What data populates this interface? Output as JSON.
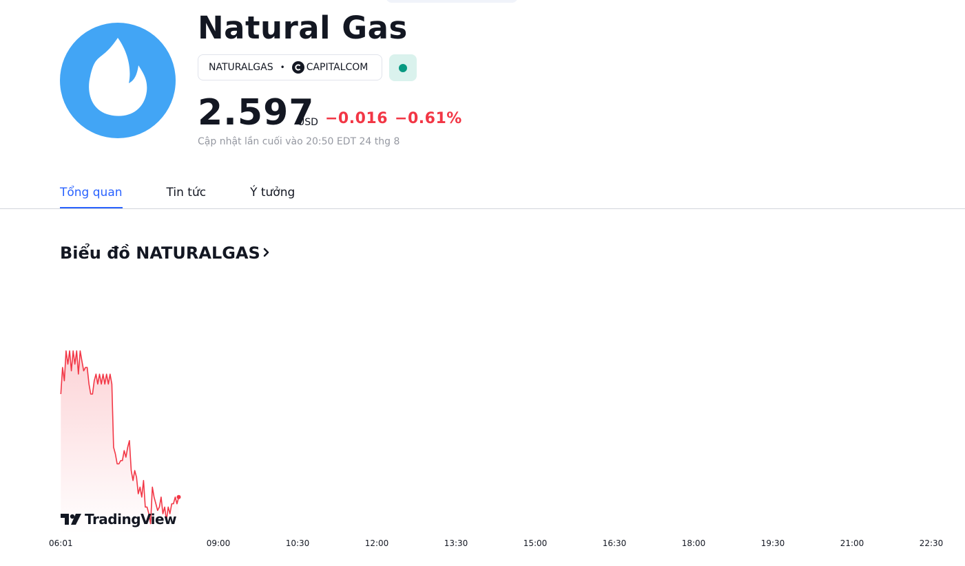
{
  "instrument": {
    "name": "Natural Gas",
    "symbol": "NATURALGAS",
    "separator": "•",
    "exchange": "CAPITALCOM",
    "logo_icon": "flame-icon",
    "logo_color": "#42a5f5",
    "market_status_color": "#089981"
  },
  "quote": {
    "price": "2.597",
    "currency": "USD",
    "change": "−0.016",
    "change_percent": "−0.61%",
    "change_color": "#f23645",
    "last_updated": "Cập nhật lần cuối vào 20:50 EDT 24 thg 8"
  },
  "tabs": [
    {
      "label": "Tổng quan",
      "active": true
    },
    {
      "label": "Tin tức",
      "active": false
    },
    {
      "label": "Ý tưởng",
      "active": false
    }
  ],
  "chart_section": {
    "title": "Biểu đồ NATURALGAS",
    "chevron_icon": "chevron-right-icon",
    "watermark": "TradingView"
  },
  "chart_data": {
    "type": "area",
    "line_color": "#f23645",
    "x_tick_labels": [
      "06:01",
      "09:00",
      "10:30",
      "12:00",
      "13:30",
      "15:00",
      "16:30",
      "18:00",
      "19:30",
      "21:00",
      "22:30"
    ],
    "x": [
      "06:01",
      "06:03",
      "06:05",
      "06:07",
      "06:09",
      "06:11",
      "06:13",
      "06:15",
      "06:17",
      "06:19",
      "06:21",
      "06:23",
      "06:25",
      "06:27",
      "06:29",
      "06:31",
      "06:33",
      "06:35",
      "06:37",
      "06:39",
      "06:41",
      "06:43",
      "06:45",
      "06:47",
      "06:49",
      "06:51",
      "06:53",
      "06:55",
      "06:57",
      "06:59",
      "07:01",
      "07:03",
      "07:05",
      "07:07",
      "07:09",
      "07:11",
      "07:13",
      "07:15",
      "07:17",
      "07:19",
      "07:21",
      "07:23",
      "07:25",
      "07:27",
      "07:29",
      "07:31",
      "07:33",
      "07:35",
      "07:37",
      "07:39",
      "07:41",
      "07:43",
      "07:45",
      "07:47",
      "07:49",
      "07:51",
      "07:53",
      "07:55",
      "07:57",
      "07:59",
      "08:01",
      "08:03",
      "08:05",
      "08:07",
      "08:09",
      "08:11",
      "08:13",
      "08:15"
    ],
    "y": [
      2.628,
      2.636,
      2.632,
      2.641,
      2.637,
      2.641,
      2.635,
      2.641,
      2.637,
      2.641,
      2.634,
      2.641,
      2.638,
      2.635,
      2.636,
      2.636,
      2.631,
      2.628,
      2.628,
      2.632,
      2.634,
      2.631,
      2.634,
      2.631,
      2.634,
      2.631,
      2.634,
      2.631,
      2.634,
      2.631,
      2.612,
      2.61,
      2.607,
      2.607,
      2.608,
      2.608,
      2.611,
      2.609,
      2.612,
      2.614,
      2.605,
      2.602,
      2.605,
      2.603,
      2.598,
      2.6,
      2.597,
      2.602,
      2.594,
      2.594,
      2.592,
      2.589,
      2.6,
      2.597,
      2.595,
      2.593,
      2.594,
      2.597,
      2.592,
      2.594,
      2.59,
      2.594,
      2.592,
      2.595,
      2.595,
      2.597,
      2.595,
      2.597
    ],
    "y_range": [
      2.586,
      2.646
    ],
    "grid": false
  }
}
